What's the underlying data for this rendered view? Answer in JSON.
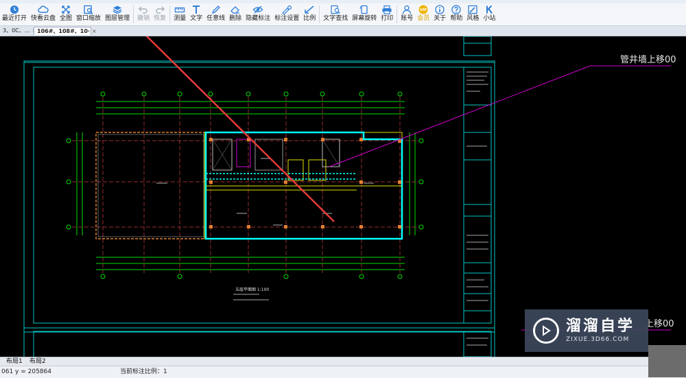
{
  "toolbar": {
    "buttons": [
      {
        "label": "最近打开",
        "icon": "clock-icon"
      },
      {
        "label": "快看云盘",
        "icon": "cloud-icon"
      },
      {
        "label": "全图",
        "icon": "expand-icon"
      },
      {
        "label": "窗口缩放",
        "icon": "zoom-window-icon"
      },
      {
        "label": "图层管理",
        "icon": "layers-icon"
      },
      {
        "label": "撤销",
        "icon": "undo-icon",
        "disabled": true
      },
      {
        "label": "恢复",
        "icon": "redo-icon",
        "disabled": true
      },
      {
        "label": "测量",
        "icon": "ruler-icon"
      },
      {
        "label": "文字",
        "icon": "text-icon"
      },
      {
        "label": "任意线",
        "icon": "pen-icon"
      },
      {
        "label": "删除",
        "icon": "eraser-icon"
      },
      {
        "label": "隐藏标注",
        "icon": "eye-hide-icon"
      },
      {
        "label": "标注设置",
        "icon": "annotation-settings-icon"
      },
      {
        "label": "比例",
        "icon": "scale-icon"
      },
      {
        "label": "文字查找",
        "icon": "text-search-icon"
      },
      {
        "label": "屏幕旋转",
        "icon": "rotate-screen-icon"
      },
      {
        "label": "打印",
        "icon": "printer-icon"
      },
      {
        "label": "账号",
        "icon": "user-icon"
      },
      {
        "label": "会员",
        "icon": "vip-icon"
      },
      {
        "label": "关于",
        "icon": "info-icon"
      },
      {
        "label": "帮助",
        "icon": "help-icon"
      },
      {
        "label": "风格",
        "icon": "style-icon"
      },
      {
        "label": "小站",
        "icon": "k-site-icon"
      }
    ]
  },
  "tabs": [
    {
      "label": "3、0C、…",
      "close": "×"
    },
    {
      "label": "106#、108#、10·",
      "close": "×"
    }
  ],
  "drawing": {
    "annotation_1": "管井墙上移00",
    "annotation_2": "上移00",
    "plan_title": "五层平面图 1:100"
  },
  "layouts": {
    "tab_1": "布局1",
    "tab_2": "布局2"
  },
  "status": {
    "coords": "061 y = 205864",
    "scale": "当前标注比例：1"
  },
  "watermark": {
    "brand": "溜溜自学",
    "url": "ZIXUE.3D66.COM"
  },
  "colors": {
    "canvas": "#000000",
    "frame": "#00c8c8",
    "grid": "#00e000",
    "wall_cyan": "#00ffff",
    "magenta": "#d000d0",
    "arrow": "#e83a3a"
  }
}
